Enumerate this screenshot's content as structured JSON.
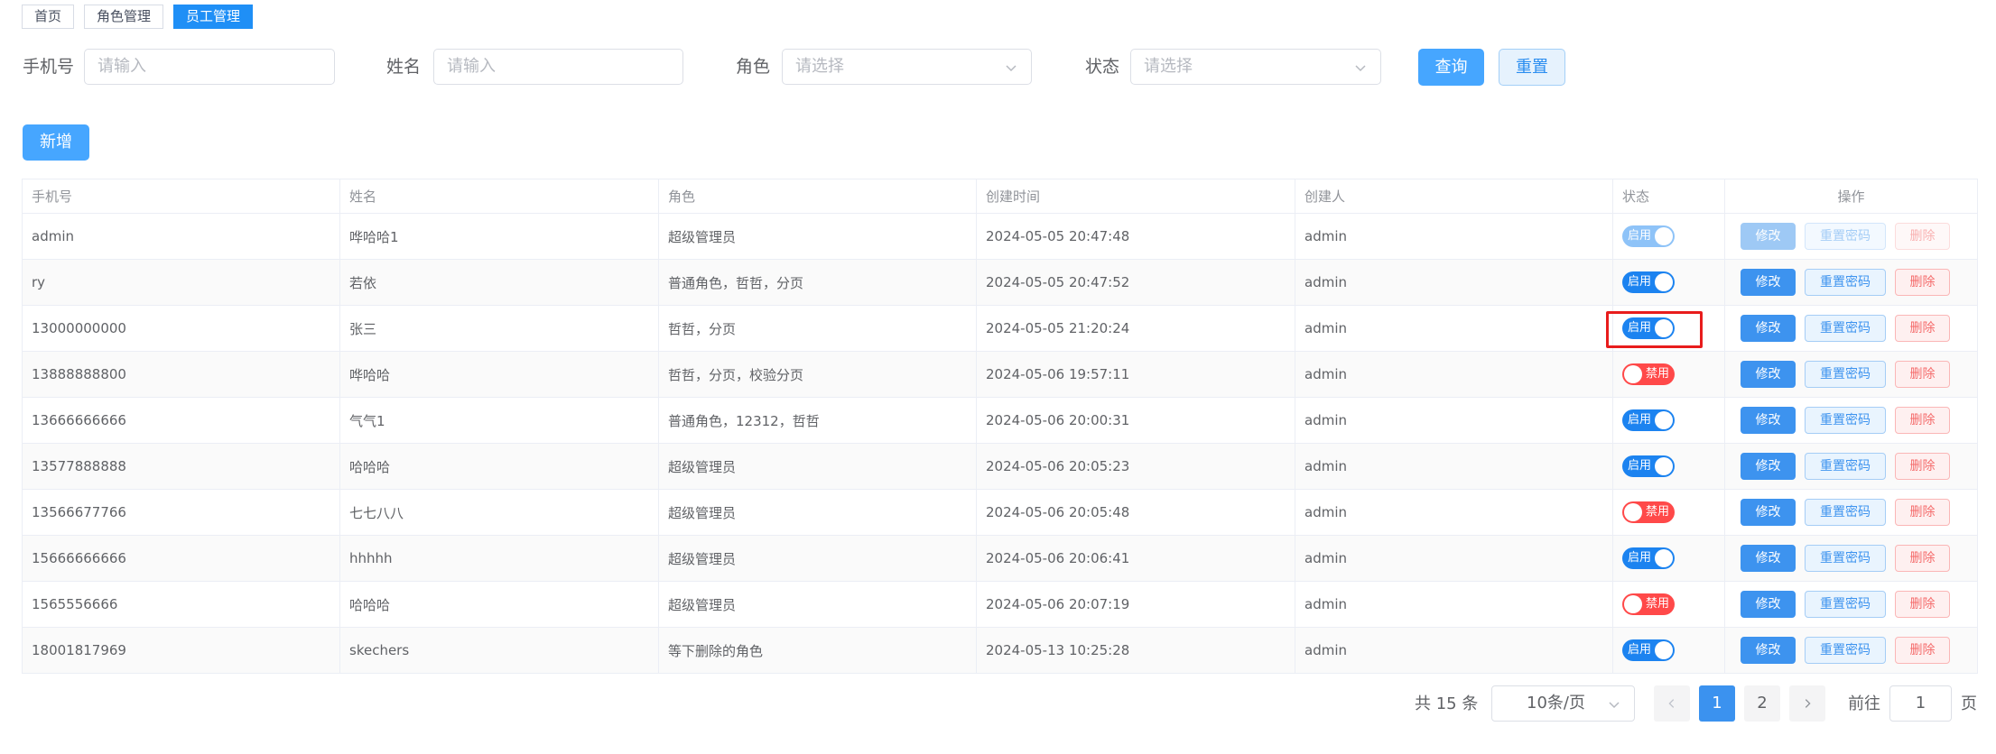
{
  "tags": [
    {
      "label": "首页",
      "active": false
    },
    {
      "label": "角色管理",
      "active": false
    },
    {
      "label": "员工管理",
      "active": true
    }
  ],
  "filters": {
    "phone": {
      "label": "手机号",
      "placeholder": "请输入"
    },
    "name": {
      "label": "姓名",
      "placeholder": "请输入"
    },
    "role": {
      "label": "角色",
      "placeholder": "请选择"
    },
    "status": {
      "label": "状态",
      "placeholder": "请选择"
    },
    "query_label": "查询",
    "reset_label": "重置"
  },
  "toolbar": {
    "add_label": "新增"
  },
  "table": {
    "headers": [
      "手机号",
      "姓名",
      "角色",
      "创建时间",
      "创建人",
      "状态",
      "操作"
    ],
    "rows": [
      {
        "phone": "admin",
        "name": "哗哈哈1",
        "role": "超级管理员",
        "created": "2024-05-05 20:47:48",
        "creator": "admin",
        "status": "启用",
        "enabled": true,
        "locked": true
      },
      {
        "phone": "ry",
        "name": "若依",
        "role": "普通角色，哲哲，分页",
        "created": "2024-05-05 20:47:52",
        "creator": "admin",
        "status": "启用",
        "enabled": true,
        "locked": false
      },
      {
        "phone": "13000000000",
        "name": "张三",
        "role": "哲哲，分页",
        "created": "2024-05-05 21:20:24",
        "creator": "admin",
        "status": "启用",
        "enabled": true,
        "locked": false
      },
      {
        "phone": "13888888800",
        "name": "哗哈哈",
        "role": "哲哲，分页，校验分页",
        "created": "2024-05-06 19:57:11",
        "creator": "admin",
        "status": "禁用",
        "enabled": false,
        "locked": false
      },
      {
        "phone": "13666666666",
        "name": "气气1",
        "role": "普通角色，12312，哲哲",
        "created": "2024-05-06 20:00:31",
        "creator": "admin",
        "status": "启用",
        "enabled": true,
        "locked": false
      },
      {
        "phone": "13577888888",
        "name": "哈哈哈",
        "role": "超级管理员",
        "created": "2024-05-06 20:05:23",
        "creator": "admin",
        "status": "启用",
        "enabled": true,
        "locked": false
      },
      {
        "phone": "13566677766",
        "name": "七七八八",
        "role": "超级管理员",
        "created": "2024-05-06 20:05:48",
        "creator": "admin",
        "status": "禁用",
        "enabled": false,
        "locked": false
      },
      {
        "phone": "15666666666",
        "name": "hhhhh",
        "role": "超级管理员",
        "created": "2024-05-06 20:06:41",
        "creator": "admin",
        "status": "启用",
        "enabled": true,
        "locked": false
      },
      {
        "phone": "1565556666",
        "name": "哈哈哈",
        "role": "超级管理员",
        "created": "2024-05-06 20:07:19",
        "creator": "admin",
        "status": "禁用",
        "enabled": false,
        "locked": false
      },
      {
        "phone": "18001817969",
        "name": "skechers",
        "role": "等下删除的角色",
        "created": "2024-05-13 10:25:28",
        "creator": "admin",
        "status": "启用",
        "enabled": true,
        "locked": false
      }
    ],
    "actions": {
      "edit": "修改",
      "reset_pwd": "重置密码",
      "delete": "删除"
    }
  },
  "pagination": {
    "total": "共 15 条",
    "page_size": "10条/页",
    "pages": [
      "1",
      "2"
    ],
    "current": "1",
    "goto_label": "前往",
    "goto_value": "1",
    "page_suffix": "页"
  },
  "icons": {
    "prev": "chevron-left-icon",
    "next": "chevron-right-icon",
    "dropdown": "chevron-down-icon"
  },
  "colors": {
    "primary": "#1f8ff6",
    "danger": "#ff4949",
    "highlight": "#e81c1c"
  }
}
